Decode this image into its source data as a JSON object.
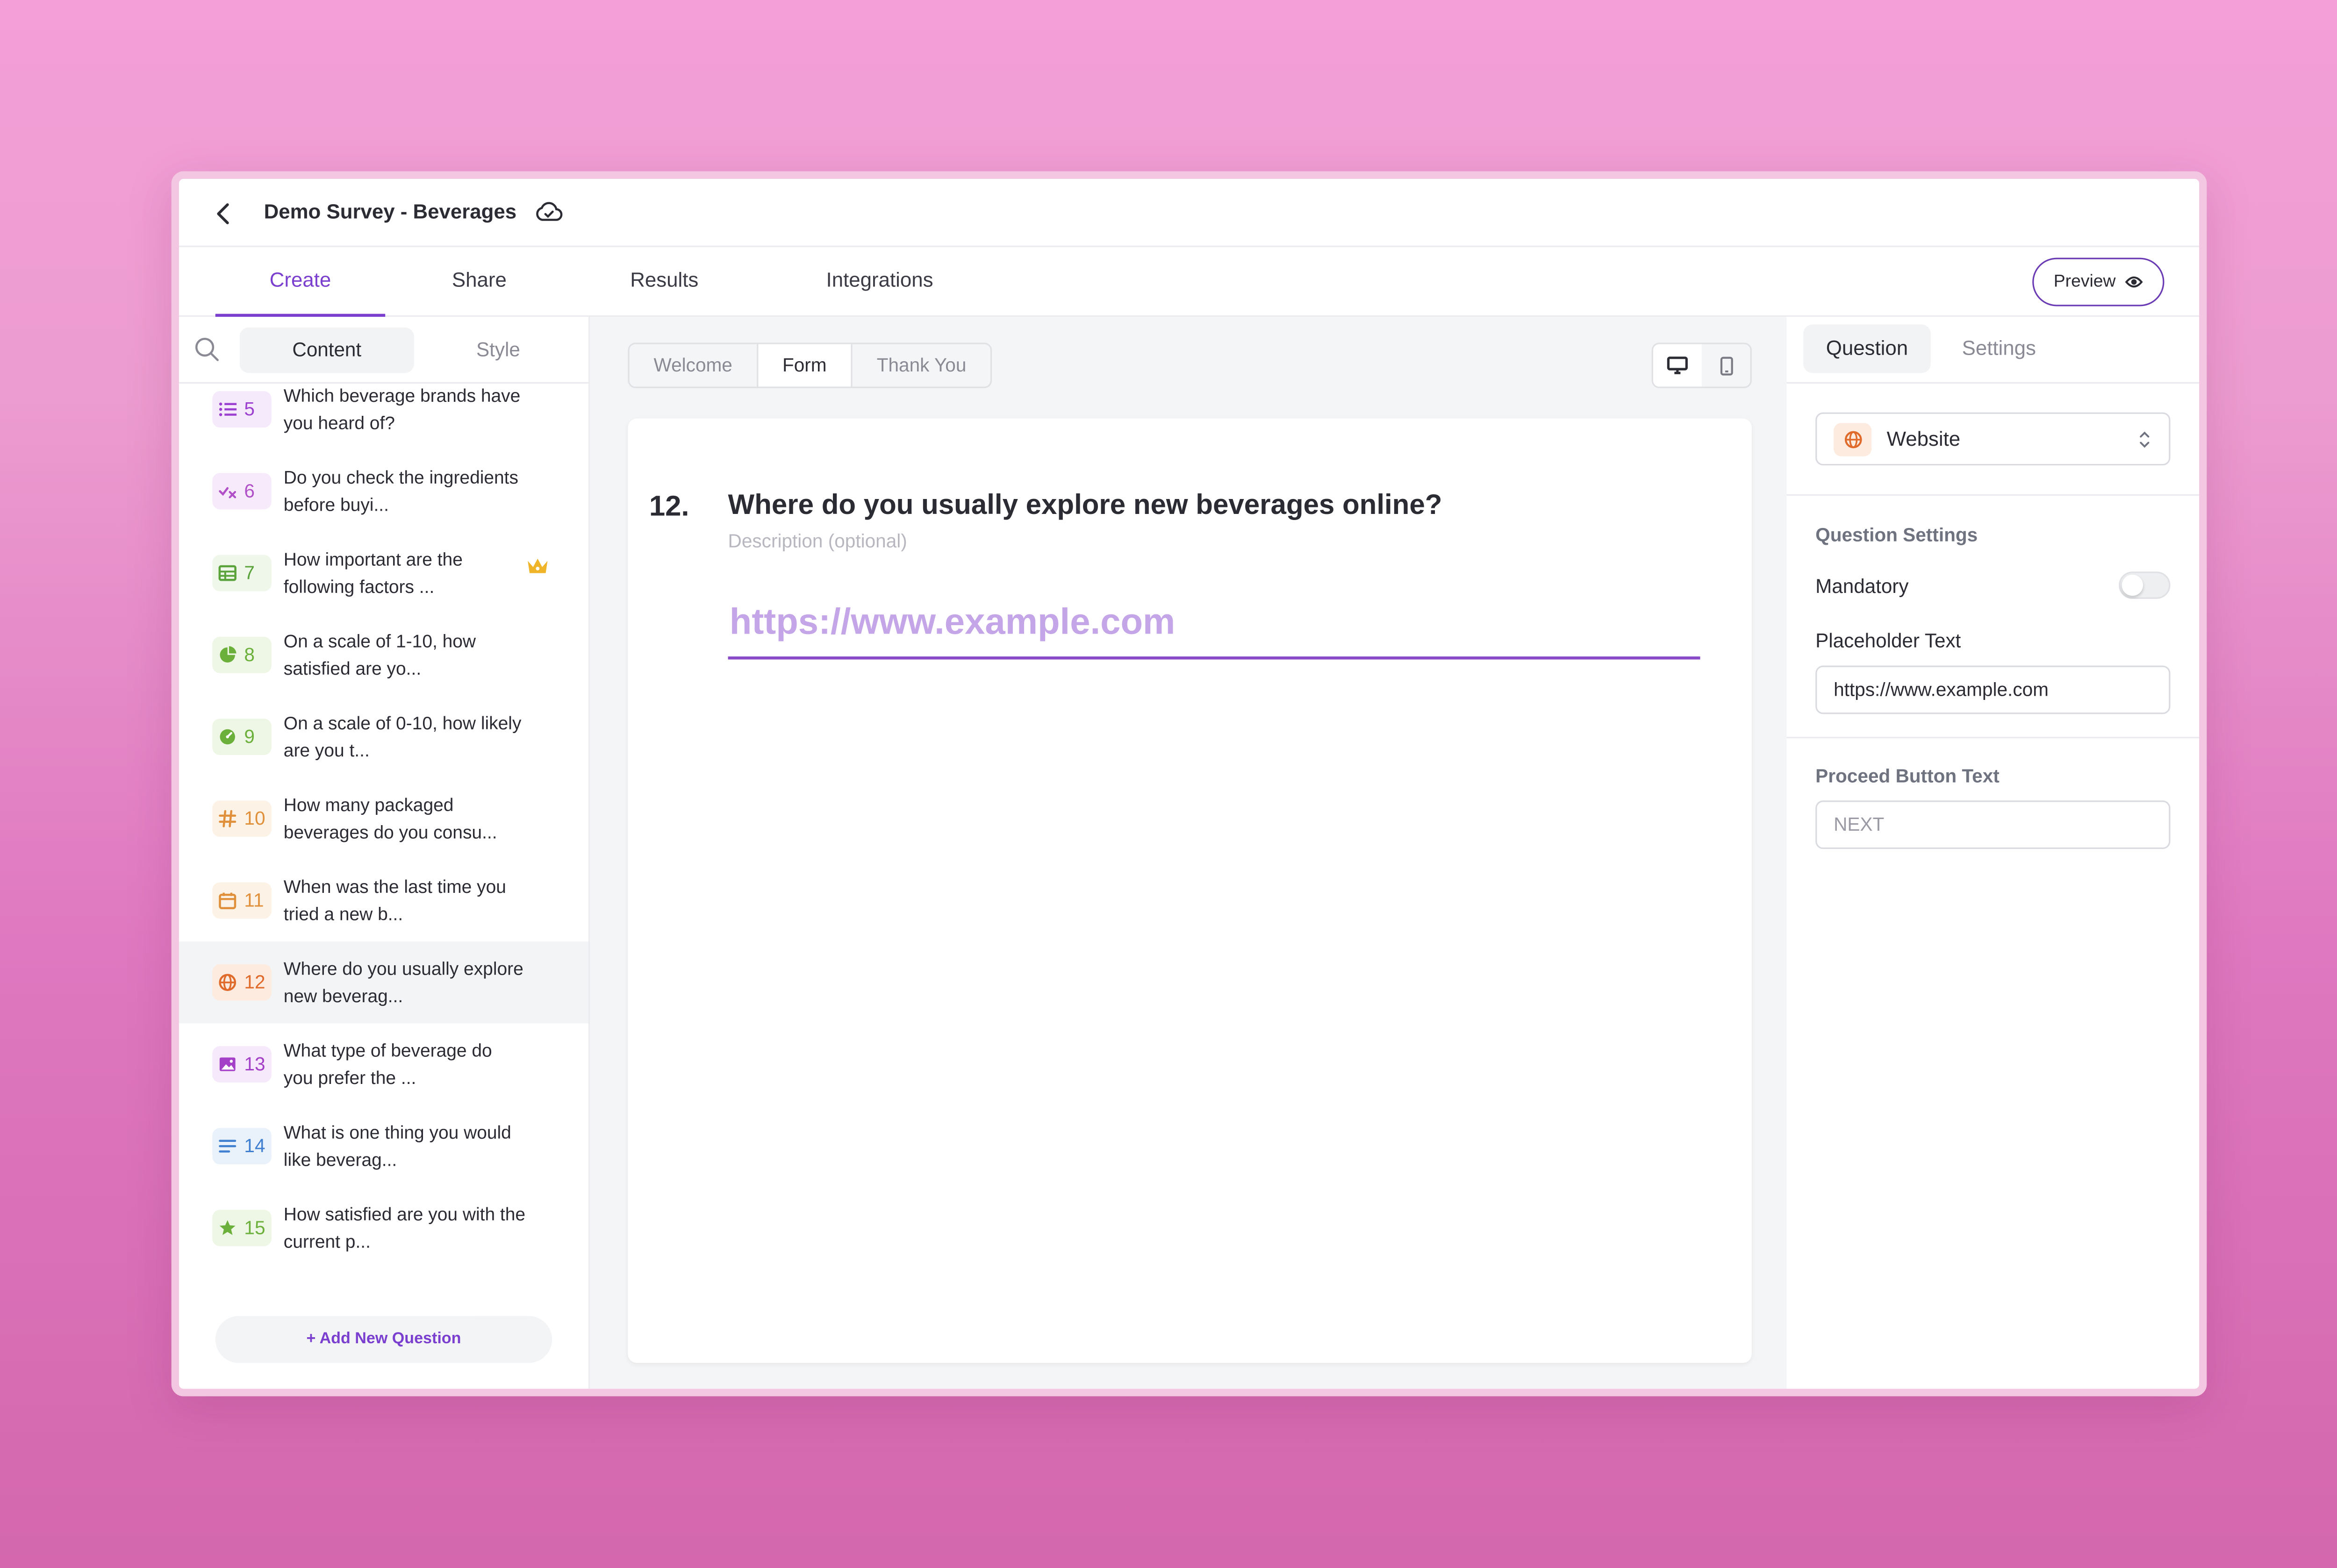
{
  "header": {
    "title": "Demo Survey - Beverages"
  },
  "tabs": [
    {
      "label": "Create"
    },
    {
      "label": "Share"
    },
    {
      "label": "Results"
    },
    {
      "label": "Integrations"
    }
  ],
  "preview_label": "Preview",
  "sidebar": {
    "tabs": [
      {
        "label": "Content"
      },
      {
        "label": "Style"
      }
    ],
    "questions": [
      {
        "num": "5",
        "text": "Which beverage brands have you heard of?",
        "icon": "list-icon",
        "color": "#9b3fd0",
        "bg": "#f5eafc"
      },
      {
        "num": "6",
        "text": "Do you check the ingredients before buyi...",
        "icon": "yes-no-icon",
        "color": "#b04fc8",
        "bg": "#f7ebfb"
      },
      {
        "num": "7",
        "text": "How important are the following factors ...",
        "icon": "matrix-icon",
        "color": "#5aa33a",
        "bg": "#eef7e9",
        "premium": true
      },
      {
        "num": "8",
        "text": "On a scale of 1-10, how satisfied are yo...",
        "icon": "pie-icon",
        "color": "#6bb03a",
        "bg": "#eef7e6"
      },
      {
        "num": "9",
        "text": "On a scale of 0-10, how likely are you t...",
        "icon": "gauge-icon",
        "color": "#6bb03a",
        "bg": "#eef7e6"
      },
      {
        "num": "10",
        "text": "How many packaged beverages do you consu...",
        "icon": "hash-icon",
        "color": "#e0903a",
        "bg": "#fdf2e6"
      },
      {
        "num": "11",
        "text": "When was the last time you tried a new b...",
        "icon": "calendar-icon",
        "color": "#e0903a",
        "bg": "#fdf2e6"
      },
      {
        "num": "12",
        "text": "Where do you usually explore new beverag...",
        "icon": "globe-icon",
        "color": "#e06a2a",
        "bg": "#fdebe0"
      },
      {
        "num": "13",
        "text": "What type of beverage do you prefer the ...",
        "icon": "image-icon",
        "color": "#a43fc8",
        "bg": "#f6e9fb"
      },
      {
        "num": "14",
        "text": "What is one thing you would like beverag...",
        "icon": "text-lines-icon",
        "color": "#3f7fd0",
        "bg": "#e9f1fb"
      },
      {
        "num": "15",
        "text": "How satisfied are you with the current p...",
        "icon": "star-icon",
        "color": "#6bb03a",
        "bg": "#eef7e6"
      }
    ],
    "add_question_label": "+ Add New Question"
  },
  "center": {
    "sections": [
      {
        "label": "Welcome"
      },
      {
        "label": "Form"
      },
      {
        "label": "Thank You"
      }
    ],
    "question": {
      "number": "12.",
      "title": "Where do you usually explore new beverages online?",
      "description": "Description (optional)",
      "placeholder": "https://www.example.com"
    }
  },
  "right": {
    "tabs": [
      {
        "label": "Question"
      },
      {
        "label": "Settings"
      }
    ],
    "type_label": "Website",
    "question_settings_title": "Question Settings",
    "mandatory_label": "Mandatory",
    "mandatory": false,
    "placeholder_label": "Placeholder Text",
    "placeholder_value": "https://www.example.com",
    "proceed_title": "Proceed Button Text",
    "proceed_placeholder": "NEXT"
  },
  "colors": {
    "accent": "#7b3fd0",
    "selected_row": "#f3f4f6"
  }
}
